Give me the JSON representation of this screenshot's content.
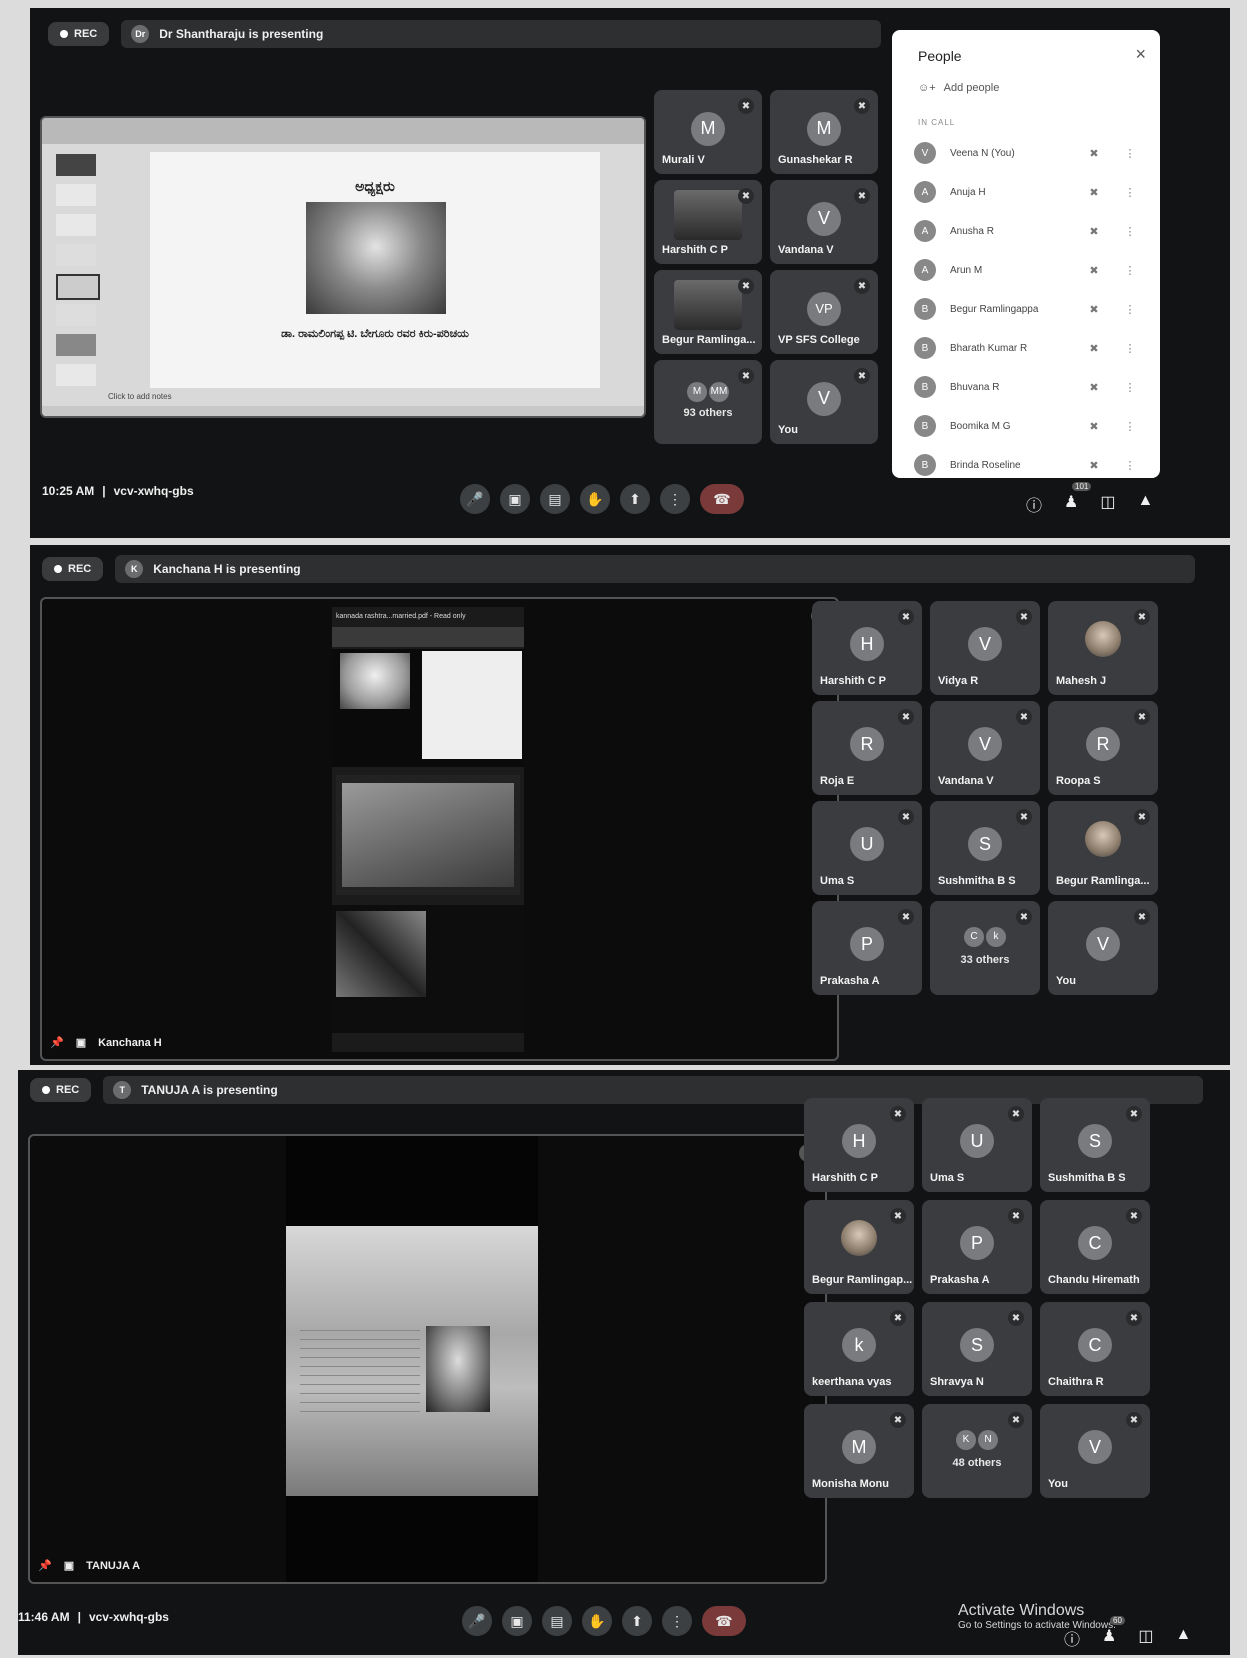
{
  "screens": [
    {
      "rec": "REC",
      "presenter_avatar": "Dr",
      "presenting": "Dr Shantharaju is presenting",
      "time": "10:25 AM",
      "meeting_code": "vcv-xwhq-gbs",
      "slide": {
        "title": "ಅಧ್ಯಕ್ಷರು",
        "caption": "ಡಾ. ರಾಮಲಿಂಗಪ್ಪ ಟಿ. ಬೇಗೂರು ರವರ ಕಿರು-ಪರಿಚಯ",
        "notes": "Click to add notes"
      },
      "tiles": [
        {
          "initial": "M",
          "name": "Murali V"
        },
        {
          "initial": "M",
          "name": "Gunashekar R"
        },
        {
          "initial": "",
          "name": "Harshith C P",
          "photo": true
        },
        {
          "initial": "V",
          "name": "Vandana V"
        },
        {
          "initial": "",
          "name": "Begur Ramlinga...",
          "photo": true
        },
        {
          "initial": "VP",
          "name": "VP SFS College"
        },
        {
          "initial": "",
          "name": "93 others",
          "others": [
            "M",
            "MM"
          ]
        },
        {
          "initial": "V",
          "name": "You"
        }
      ],
      "people_panel": {
        "title": "People",
        "close": "×",
        "add": "Add people",
        "section": "IN CALL",
        "rows": [
          {
            "initial": "V",
            "name": "Veena N (You)"
          },
          {
            "initial": "A",
            "name": "Anuja H"
          },
          {
            "initial": "A",
            "name": "Anusha R"
          },
          {
            "initial": "A",
            "name": "Arun M"
          },
          {
            "initial": "B",
            "name": "Begur Ramlingappa"
          },
          {
            "initial": "B",
            "name": "Bharath Kumar R"
          },
          {
            "initial": "B",
            "name": "Bhuvana R"
          },
          {
            "initial": "B",
            "name": "Boomika M G"
          },
          {
            "initial": "B",
            "name": "Brinda Roseline"
          }
        ]
      },
      "people_count": "101"
    },
    {
      "rec": "REC",
      "presenter_avatar": "K",
      "presenting": "Kanchana H is presenting",
      "stage_caption": "Kanchana H",
      "doc_header": "kannada rashtra...married.pdf - Read only",
      "tiles": [
        {
          "initial": "H",
          "name": "Harshith C P"
        },
        {
          "initial": "V",
          "name": "Vidya R"
        },
        {
          "initial": "",
          "name": "Mahesh J",
          "photo": true
        },
        {
          "initial": "R",
          "name": "Roja E"
        },
        {
          "initial": "V",
          "name": "Vandana V"
        },
        {
          "initial": "R",
          "name": "Roopa S"
        },
        {
          "initial": "U",
          "name": "Uma S"
        },
        {
          "initial": "S",
          "name": "Sushmitha B S"
        },
        {
          "initial": "",
          "name": "Begur Ramlinga...",
          "photo": true
        },
        {
          "initial": "P",
          "name": "Prakasha A"
        },
        {
          "initial": "",
          "name": "33 others",
          "others": [
            "C",
            "k"
          ]
        },
        {
          "initial": "V",
          "name": "You"
        }
      ]
    },
    {
      "rec": "REC",
      "presenter_avatar": "T",
      "presenting": "TANUJA A is presenting",
      "stage_caption": "TANUJA A",
      "time": "11:46 AM",
      "meeting_code": "vcv-xwhq-gbs",
      "tiles": [
        {
          "initial": "H",
          "name": "Harshith C P"
        },
        {
          "initial": "U",
          "name": "Uma S"
        },
        {
          "initial": "S",
          "name": "Sushmitha B S"
        },
        {
          "initial": "",
          "name": "Begur Ramlingap...",
          "photo": true
        },
        {
          "initial": "P",
          "name": "Prakasha A"
        },
        {
          "initial": "C",
          "name": "Chandu Hiremath"
        },
        {
          "initial": "k",
          "name": "keerthana vyas"
        },
        {
          "initial": "S",
          "name": "Shravya N"
        },
        {
          "initial": "C",
          "name": "Chaithra R"
        },
        {
          "initial": "M",
          "name": "Monisha Monu"
        },
        {
          "initial": "",
          "name": "48 others",
          "others": [
            "K",
            "N"
          ]
        },
        {
          "initial": "V",
          "name": "You"
        }
      ],
      "people_count": "60",
      "watermark": {
        "title": "Activate Windows",
        "sub": "Go to Settings to activate Windows."
      }
    }
  ]
}
